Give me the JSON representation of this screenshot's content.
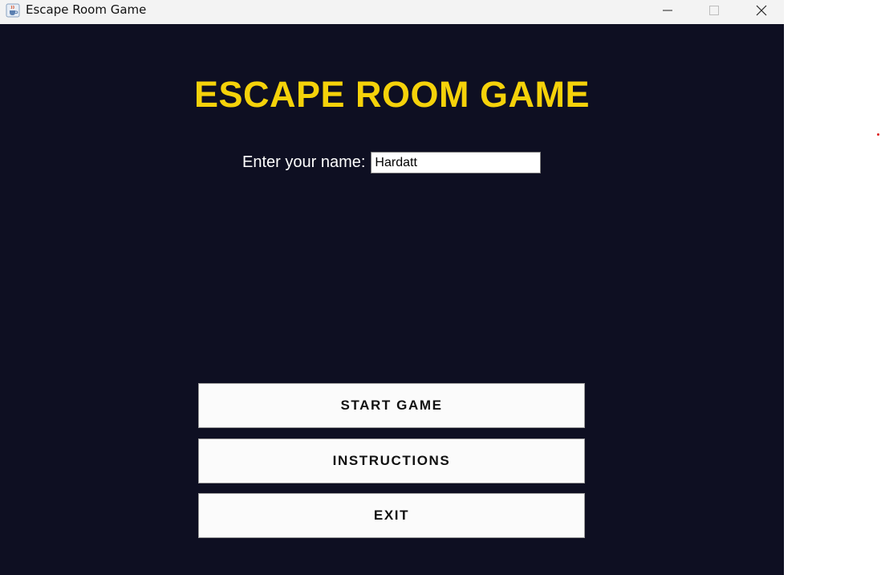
{
  "window": {
    "title": "Escape Room Game",
    "app_icon": "java-cup-icon",
    "controls": [
      "minimize-icon",
      "maximize-icon",
      "close-icon"
    ]
  },
  "main": {
    "game_title": "ESCAPE ROOM GAME",
    "name_label": "Enter your name:",
    "name_value": "Hardatt"
  },
  "buttons": {
    "start": "START GAME",
    "instructions": "INSTRUCTIONS",
    "exit": "EXIT"
  },
  "colors": {
    "background": "#0e0f22",
    "title": "#f5d20a",
    "label": "#ffffff",
    "button_bg": "#fbfbfb"
  }
}
